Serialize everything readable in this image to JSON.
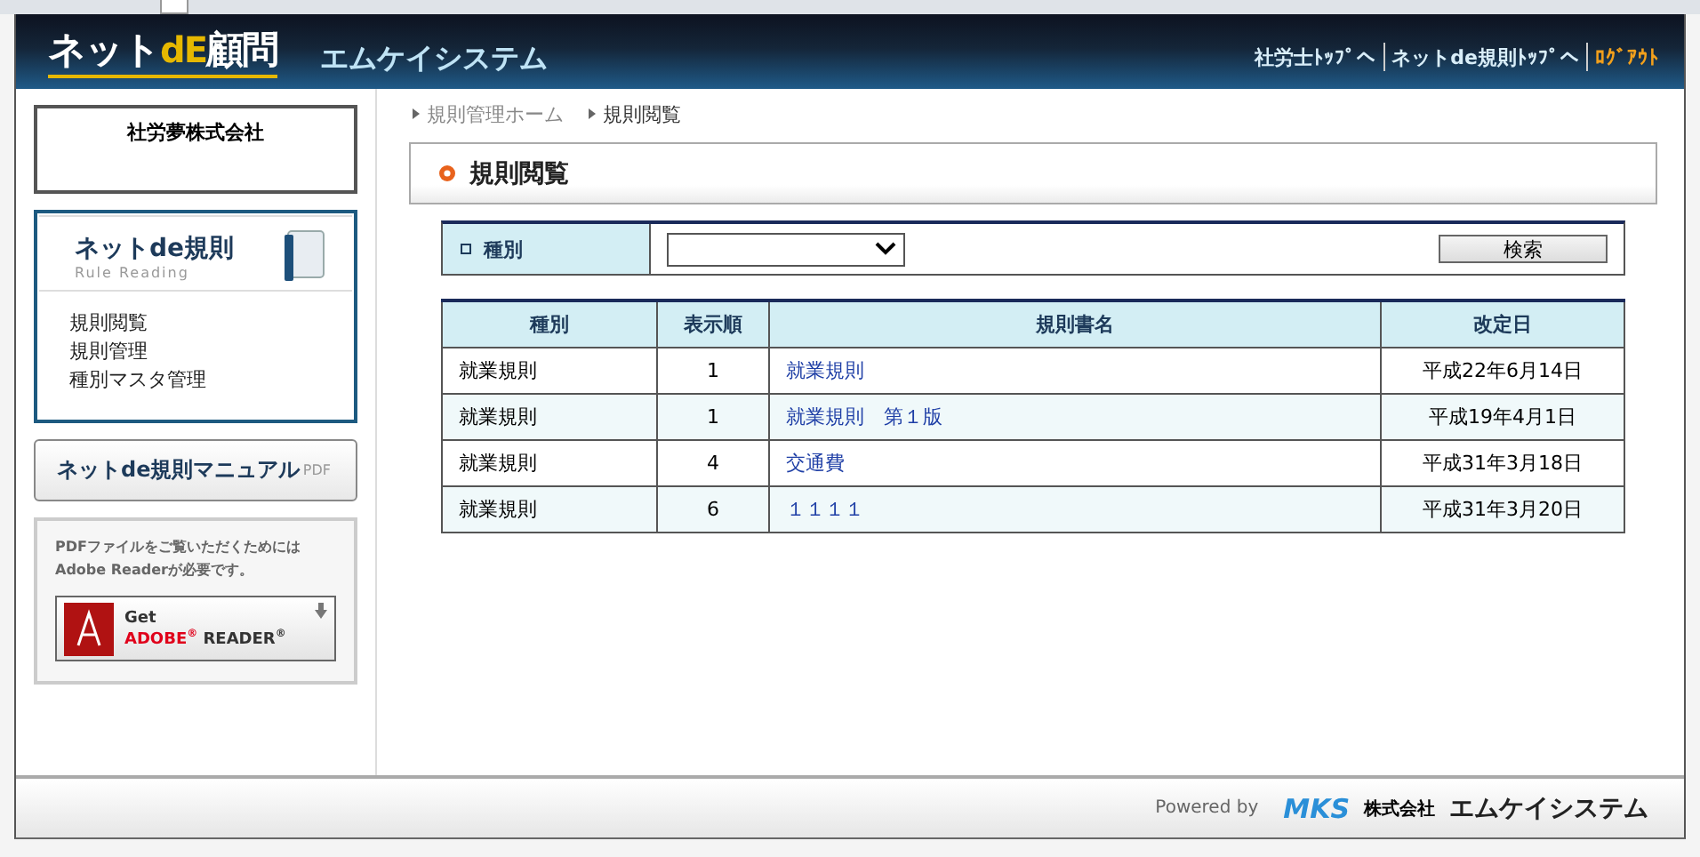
{
  "header": {
    "logo": {
      "part_1": "ネット",
      "part_2": "dE",
      "part_3": "顧問"
    },
    "company": "エムケイシステム",
    "links": [
      {
        "label": "社労士ﾄｯﾌﾟへ",
        "kind": "normal"
      },
      {
        "label": "ネットde規則ﾄｯﾌﾟへ",
        "kind": "normal"
      },
      {
        "label": "ﾛｸﾞｱｳﾄ",
        "kind": "logout"
      }
    ]
  },
  "sidebar": {
    "client": "社労夢株式会社",
    "menu_box": {
      "title": "ネットde規則",
      "subtitle": "Rule Reading",
      "items": [
        "規則閲覧",
        "規則管理",
        "種別マスタ管理"
      ]
    },
    "manual_button": {
      "label": "ネットde規則マニュアル",
      "tag": "PDF"
    },
    "reader_box": {
      "note": "PDFファイルをご覧いただくためには\nAdobe Readerが必要です。",
      "badge": {
        "line_1": "Get",
        "brand": "ADOBE",
        "mark": "®",
        "product": "READER",
        "mark_2": "®"
      }
    }
  },
  "breadcrumb": [
    "規則管理ホーム",
    "規則閲覧"
  ],
  "page_title": "規則閲覧",
  "filter": {
    "label": "種別",
    "button": "検索"
  },
  "table": {
    "columns": [
      "種別",
      "表示順",
      "規則書名",
      "改定日"
    ],
    "rows": [
      [
        "就業規則",
        "1",
        "就業規則",
        "平成22年6月14日"
      ],
      [
        "就業規則",
        "1",
        "就業規則　第１版",
        "平成19年4月1日"
      ],
      [
        "就業規則",
        "4",
        "交通費",
        "平成31年3月18日"
      ],
      [
        "就業規則",
        "6",
        "１１１１",
        "平成31年3月20日"
      ]
    ]
  },
  "footer": {
    "powered": "Powered by",
    "logo": "MKS",
    "company_prefix": "株式会社",
    "company": "エムケイシステム"
  }
}
